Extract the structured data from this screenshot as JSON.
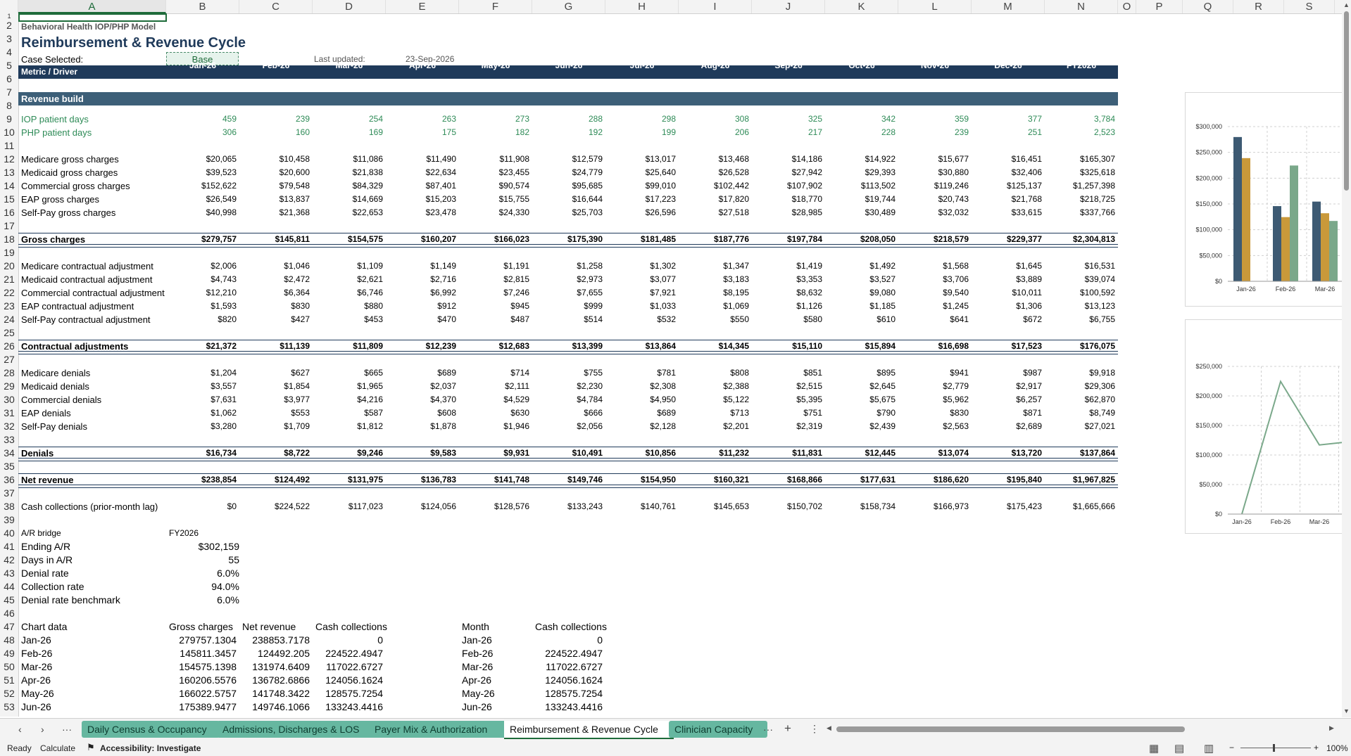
{
  "column_headers": [
    "A",
    "B",
    "C",
    "D",
    "E",
    "F",
    "G",
    "H",
    "I",
    "J",
    "K",
    "L",
    "M",
    "N",
    "O",
    "P",
    "Q",
    "R",
    "S"
  ],
  "row_numbers": [
    "1",
    "2",
    "3",
    "4",
    "5",
    "6",
    "7",
    "8",
    "9",
    "10",
    "11",
    "12",
    "13",
    "14",
    "15",
    "16",
    "17",
    "18",
    "19",
    "20",
    "21",
    "22",
    "23",
    "24",
    "25",
    "26",
    "27",
    "28",
    "29",
    "30",
    "31",
    "32",
    "33",
    "34",
    "35",
    "36",
    "37",
    "38",
    "39",
    "40",
    "41",
    "42",
    "43",
    "44",
    "45",
    "46",
    "47",
    "48",
    "49",
    "50",
    "51",
    "52",
    "53"
  ],
  "header": {
    "model_name": "Behavioral Health IOP/PHP Model",
    "title": "Reimbursement & Revenue Cycle",
    "case_label": "Case Selected:",
    "case_value": "Base",
    "updated_label": "Last updated:",
    "updated_value": "23-Sep-2026"
  },
  "band_header": {
    "label": "Metric / Driver",
    "months": [
      "Jan-26",
      "Feb-26",
      "Mar-26",
      "Apr-26",
      "May-26",
      "Jun-26",
      "Jul-26",
      "Aug-26",
      "Sep-26",
      "Oct-26",
      "Nov-26",
      "Dec-26",
      "FY2026"
    ]
  },
  "section_title": "Revenue build",
  "rows": [
    {
      "row": 9,
      "label": "IOP patient days",
      "green": true,
      "values": [
        "459",
        "239",
        "254",
        "263",
        "273",
        "288",
        "298",
        "308",
        "325",
        "342",
        "359",
        "377",
        "3,784"
      ]
    },
    {
      "row": 10,
      "label": "PHP patient days",
      "green": true,
      "values": [
        "306",
        "160",
        "169",
        "175",
        "182",
        "192",
        "199",
        "206",
        "217",
        "228",
        "239",
        "251",
        "2,523"
      ]
    },
    {
      "row": 12,
      "label": "Medicare gross charges",
      "values": [
        "$20,065",
        "$10,458",
        "$11,086",
        "$11,490",
        "$11,908",
        "$12,579",
        "$13,017",
        "$13,468",
        "$14,186",
        "$14,922",
        "$15,677",
        "$16,451",
        "$165,307"
      ]
    },
    {
      "row": 13,
      "label": "Medicaid gross charges",
      "values": [
        "$39,523",
        "$20,600",
        "$21,838",
        "$22,634",
        "$23,455",
        "$24,779",
        "$25,640",
        "$26,528",
        "$27,942",
        "$29,393",
        "$30,880",
        "$32,406",
        "$325,618"
      ]
    },
    {
      "row": 14,
      "label": "Commercial gross charges",
      "values": [
        "$152,622",
        "$79,548",
        "$84,329",
        "$87,401",
        "$90,574",
        "$95,685",
        "$99,010",
        "$102,442",
        "$107,902",
        "$113,502",
        "$119,246",
        "$125,137",
        "$1,257,398"
      ]
    },
    {
      "row": 15,
      "label": "EAP gross charges",
      "values": [
        "$26,549",
        "$13,837",
        "$14,669",
        "$15,203",
        "$15,755",
        "$16,644",
        "$17,223",
        "$17,820",
        "$18,770",
        "$19,744",
        "$20,743",
        "$21,768",
        "$218,725"
      ]
    },
    {
      "row": 16,
      "label": "Self-Pay gross charges",
      "values": [
        "$40,998",
        "$21,368",
        "$22,653",
        "$23,478",
        "$24,330",
        "$25,703",
        "$26,596",
        "$27,518",
        "$28,985",
        "$30,489",
        "$32,032",
        "$33,615",
        "$337,766"
      ]
    },
    {
      "row": 18,
      "label": "Gross charges",
      "bold": true,
      "total": true,
      "values": [
        "$279,757",
        "$145,811",
        "$154,575",
        "$160,207",
        "$166,023",
        "$175,390",
        "$181,485",
        "$187,776",
        "$197,784",
        "$208,050",
        "$218,579",
        "$229,377",
        "$2,304,813"
      ]
    },
    {
      "row": 20,
      "label": "Medicare contractual adjustment",
      "values": [
        "$2,006",
        "$1,046",
        "$1,109",
        "$1,149",
        "$1,191",
        "$1,258",
        "$1,302",
        "$1,347",
        "$1,419",
        "$1,492",
        "$1,568",
        "$1,645",
        "$16,531"
      ]
    },
    {
      "row": 21,
      "label": "Medicaid contractual adjustment",
      "values": [
        "$4,743",
        "$2,472",
        "$2,621",
        "$2,716",
        "$2,815",
        "$2,973",
        "$3,077",
        "$3,183",
        "$3,353",
        "$3,527",
        "$3,706",
        "$3,889",
        "$39,074"
      ]
    },
    {
      "row": 22,
      "label": "Commercial contractual adjustment",
      "values": [
        "$12,210",
        "$6,364",
        "$6,746",
        "$6,992",
        "$7,246",
        "$7,655",
        "$7,921",
        "$8,195",
        "$8,632",
        "$9,080",
        "$9,540",
        "$10,011",
        "$100,592"
      ]
    },
    {
      "row": 23,
      "label": "EAP contractual adjustment",
      "values": [
        "$1,593",
        "$830",
        "$880",
        "$912",
        "$945",
        "$999",
        "$1,033",
        "$1,069",
        "$1,126",
        "$1,185",
        "$1,245",
        "$1,306",
        "$13,123"
      ]
    },
    {
      "row": 24,
      "label": "Self-Pay contractual adjustment",
      "values": [
        "$820",
        "$427",
        "$453",
        "$470",
        "$487",
        "$514",
        "$532",
        "$550",
        "$580",
        "$610",
        "$641",
        "$672",
        "$6,755"
      ]
    },
    {
      "row": 26,
      "label": "Contractual adjustments",
      "bold": true,
      "total": true,
      "values": [
        "$21,372",
        "$11,139",
        "$11,809",
        "$12,239",
        "$12,683",
        "$13,399",
        "$13,864",
        "$14,345",
        "$15,110",
        "$15,894",
        "$16,698",
        "$17,523",
        "$176,075"
      ]
    },
    {
      "row": 28,
      "label": "Medicare denials",
      "values": [
        "$1,204",
        "$627",
        "$665",
        "$689",
        "$714",
        "$755",
        "$781",
        "$808",
        "$851",
        "$895",
        "$941",
        "$987",
        "$9,918"
      ]
    },
    {
      "row": 29,
      "label": "Medicaid denials",
      "values": [
        "$3,557",
        "$1,854",
        "$1,965",
        "$2,037",
        "$2,111",
        "$2,230",
        "$2,308",
        "$2,388",
        "$2,515",
        "$2,645",
        "$2,779",
        "$2,917",
        "$29,306"
      ]
    },
    {
      "row": 30,
      "label": "Commercial denials",
      "values": [
        "$7,631",
        "$3,977",
        "$4,216",
        "$4,370",
        "$4,529",
        "$4,784",
        "$4,950",
        "$5,122",
        "$5,395",
        "$5,675",
        "$5,962",
        "$6,257",
        "$62,870"
      ]
    },
    {
      "row": 31,
      "label": "EAP denials",
      "values": [
        "$1,062",
        "$553",
        "$587",
        "$608",
        "$630",
        "$666",
        "$689",
        "$713",
        "$751",
        "$790",
        "$830",
        "$871",
        "$8,749"
      ]
    },
    {
      "row": 32,
      "label": "Self-Pay denials",
      "values": [
        "$3,280",
        "$1,709",
        "$1,812",
        "$1,878",
        "$1,946",
        "$2,056",
        "$2,128",
        "$2,201",
        "$2,319",
        "$2,439",
        "$2,563",
        "$2,689",
        "$27,021"
      ]
    },
    {
      "row": 34,
      "label": "Denials",
      "bold": true,
      "total": true,
      "values": [
        "$16,734",
        "$8,722",
        "$9,246",
        "$9,583",
        "$9,931",
        "$10,491",
        "$10,856",
        "$11,232",
        "$11,831",
        "$12,445",
        "$13,074",
        "$13,720",
        "$137,864"
      ]
    },
    {
      "row": 36,
      "label": "Net revenue",
      "bold": true,
      "total": true,
      "values": [
        "$238,854",
        "$124,492",
        "$131,975",
        "$136,783",
        "$141,748",
        "$149,746",
        "$154,950",
        "$160,321",
        "$168,866",
        "$177,631",
        "$186,620",
        "$195,840",
        "$1,967,825"
      ]
    },
    {
      "row": 38,
      "label": "Cash collections (prior-month lag)",
      "values": [
        "$0",
        "$224,522",
        "$117,023",
        "$124,056",
        "$128,576",
        "$133,243",
        "$140,761",
        "$145,653",
        "$150,702",
        "$158,734",
        "$166,973",
        "$175,423",
        "$1,665,666"
      ]
    }
  ],
  "ar_bridge": {
    "label": "A/R bridge",
    "period": "FY2026",
    "items": [
      {
        "row": 41,
        "label": "Ending A/R",
        "value": "$302,159"
      },
      {
        "row": 42,
        "label": "Days in A/R",
        "value": "55"
      },
      {
        "row": 43,
        "label": "Denial rate",
        "value": "6.0%"
      },
      {
        "row": 44,
        "label": "Collection rate",
        "value": "94.0%"
      },
      {
        "row": 45,
        "label": "Denial rate benchmark",
        "value": "6.0%"
      }
    ]
  },
  "chart_table": {
    "label": "Chart data",
    "headers": [
      "Gross charges",
      "Net revenue",
      "Cash collections"
    ],
    "month_header": "Month",
    "cash_header": "Cash collections",
    "rows": [
      {
        "row": 48,
        "month": "Jan-26",
        "gross": "279757.1304",
        "net": "238853.7178",
        "cash": "0"
      },
      {
        "row": 49,
        "month": "Feb-26",
        "gross": "145811.3457",
        "net": "124492.205",
        "cash": "224522.4947"
      },
      {
        "row": 50,
        "month": "Mar-26",
        "gross": "154575.1398",
        "net": "131974.6409",
        "cash": "117022.6727"
      },
      {
        "row": 51,
        "month": "Apr-26",
        "gross": "160206.5576",
        "net": "136782.6866",
        "cash": "124056.1624"
      },
      {
        "row": 52,
        "month": "May-26",
        "gross": "166022.5757",
        "net": "141748.3422",
        "cash": "128575.7254"
      },
      {
        "row": 53,
        "month": "Jun-26",
        "gross": "175389.9477",
        "net": "149746.1066",
        "cash": "133243.4416"
      }
    ]
  },
  "chart_data": [
    {
      "type": "bar",
      "categories": [
        "Jan-26",
        "Feb-26",
        "Mar-26"
      ],
      "series": [
        {
          "values": [
            279757,
            145811,
            154575
          ],
          "color": "#3d5a73"
        },
        {
          "values": [
            238854,
            124492,
            131975
          ],
          "color": "#c9993a"
        },
        {
          "values": [
            0,
            224522,
            117023
          ],
          "color": "#7aa88a"
        }
      ],
      "yticks": [
        "$0",
        "$50,000",
        "$100,000",
        "$150,000",
        "$200,000",
        "$250,000",
        "$300,000"
      ],
      "ylim": [
        0,
        300000
      ]
    },
    {
      "type": "line",
      "categories": [
        "Jan-26",
        "Feb-26",
        "Mar-26"
      ],
      "series": [
        {
          "values": [
            0,
            224522,
            117023,
            124056
          ],
          "color": "#7aa88a"
        }
      ],
      "yticks": [
        "$0",
        "$50,000",
        "$100,000",
        "$150,000",
        "$200,000",
        "$250,000"
      ],
      "ylim": [
        0,
        250000
      ]
    }
  ],
  "sheet_tabs": {
    "tabs": [
      "Daily Census & Occupancy",
      "Admissions, Discharges & LOS",
      "Payer Mix & Authorization",
      "Reimbursement & Revenue Cycle",
      "Clinician Capacity"
    ],
    "active": 3,
    "more_label": "···",
    "add_label": "+",
    "menu_label": "⋮"
  },
  "status_bar": {
    "ready": "Ready",
    "calculate": "Calculate",
    "accessibility": "Accessibility: Investigate",
    "zoom": "100%",
    "zoom_minus": "−",
    "zoom_plus": "+"
  }
}
